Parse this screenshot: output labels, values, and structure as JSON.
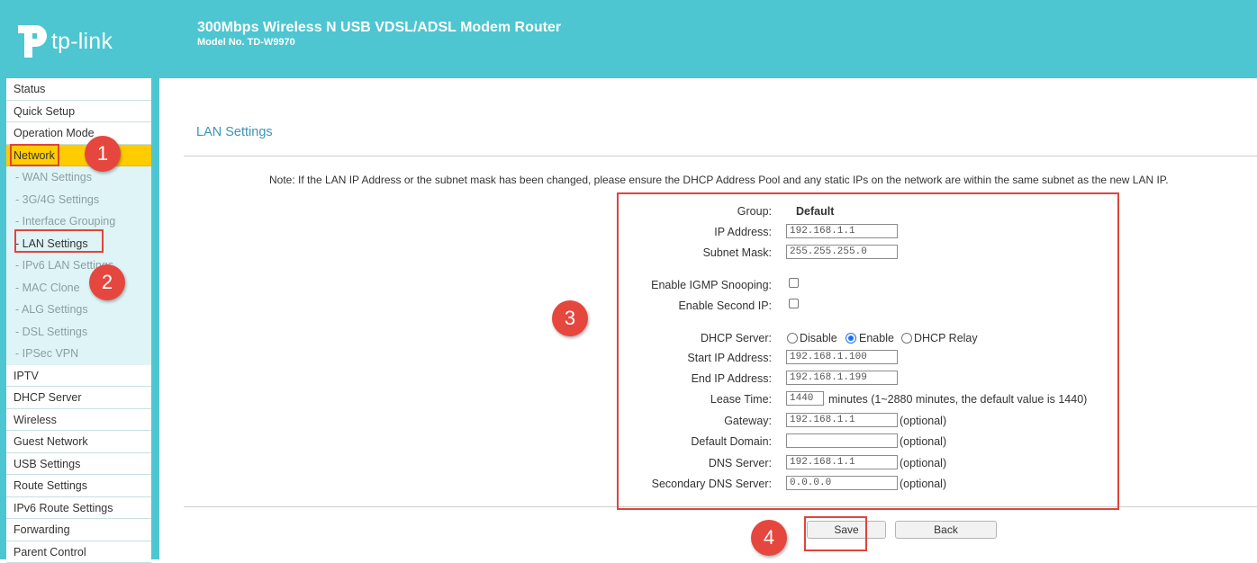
{
  "header": {
    "logo_text": "tp-link",
    "title": "300Mbps Wireless N USB VDSL/ADSL Modem Router",
    "model": "Model No. TD-W9970"
  },
  "sidebar": {
    "items": [
      {
        "label": "Status",
        "kind": "top"
      },
      {
        "label": "Quick Setup",
        "kind": "top"
      },
      {
        "label": "Operation Mode",
        "kind": "top"
      },
      {
        "label": "Network",
        "kind": "active"
      },
      {
        "label": "- WAN Settings",
        "kind": "sub"
      },
      {
        "label": "- 3G/4G Settings",
        "kind": "sub"
      },
      {
        "label": "- Interface Grouping",
        "kind": "sub"
      },
      {
        "label": "- LAN Settings",
        "kind": "subsel"
      },
      {
        "label": "- IPv6 LAN Settings",
        "kind": "sub"
      },
      {
        "label": "- MAC Clone",
        "kind": "sub"
      },
      {
        "label": "- ALG Settings",
        "kind": "sub"
      },
      {
        "label": "- DSL Settings",
        "kind": "sub"
      },
      {
        "label": "- IPSec VPN",
        "kind": "sub"
      },
      {
        "label": "IPTV",
        "kind": "top"
      },
      {
        "label": "DHCP Server",
        "kind": "top"
      },
      {
        "label": "Wireless",
        "kind": "top"
      },
      {
        "label": "Guest Network",
        "kind": "top"
      },
      {
        "label": "USB Settings",
        "kind": "top"
      },
      {
        "label": "Route Settings",
        "kind": "top"
      },
      {
        "label": "IPv6 Route Settings",
        "kind": "top"
      },
      {
        "label": "Forwarding",
        "kind": "top"
      },
      {
        "label": "Parent Control",
        "kind": "top"
      }
    ]
  },
  "main": {
    "title": "LAN Settings",
    "note": "Note: If the LAN IP Address or the subnet mask has been changed, please ensure the DHCP Address Pool and any static IPs on the network are within the same subnet as the new LAN IP.",
    "form": {
      "group_label": "Group:",
      "group_value": "Default",
      "ip_label": "IP Address:",
      "ip_value": "192.168.1.1",
      "mask_label": "Subnet Mask:",
      "mask_value": "255.255.255.0",
      "igmp_label": "Enable IGMP Snooping:",
      "igmp_checked": false,
      "second_ip_label": "Enable Second IP:",
      "second_ip_checked": false,
      "dhcp_label": "DHCP Server:",
      "dhcp_options": [
        "Disable",
        "Enable",
        "DHCP Relay"
      ],
      "dhcp_selected": "Enable",
      "start_label": "Start IP Address:",
      "start_value": "192.168.1.100",
      "end_label": "End IP Address:",
      "end_value": "192.168.1.199",
      "lease_label": "Lease Time:",
      "lease_value": "1440",
      "lease_hint": "minutes (1~2880 minutes, the default value is 1440)",
      "gateway_label": "Gateway:",
      "gateway_value": "192.168.1.1",
      "domain_label": "Default Domain:",
      "domain_value": "",
      "dns_label": "DNS Server:",
      "dns_value": "192.168.1.1",
      "dns2_label": "Secondary DNS Server:",
      "dns2_value": "0.0.0.0",
      "optional": "(optional)"
    },
    "save_label": "Save",
    "back_label": "Back"
  },
  "annotations": {
    "badges": [
      "1",
      "2",
      "3",
      "4"
    ],
    "color": "#e5473f"
  },
  "colors": {
    "brand": "#4dc6d1",
    "active": "#ffcc00",
    "title": "#3b95b8"
  }
}
